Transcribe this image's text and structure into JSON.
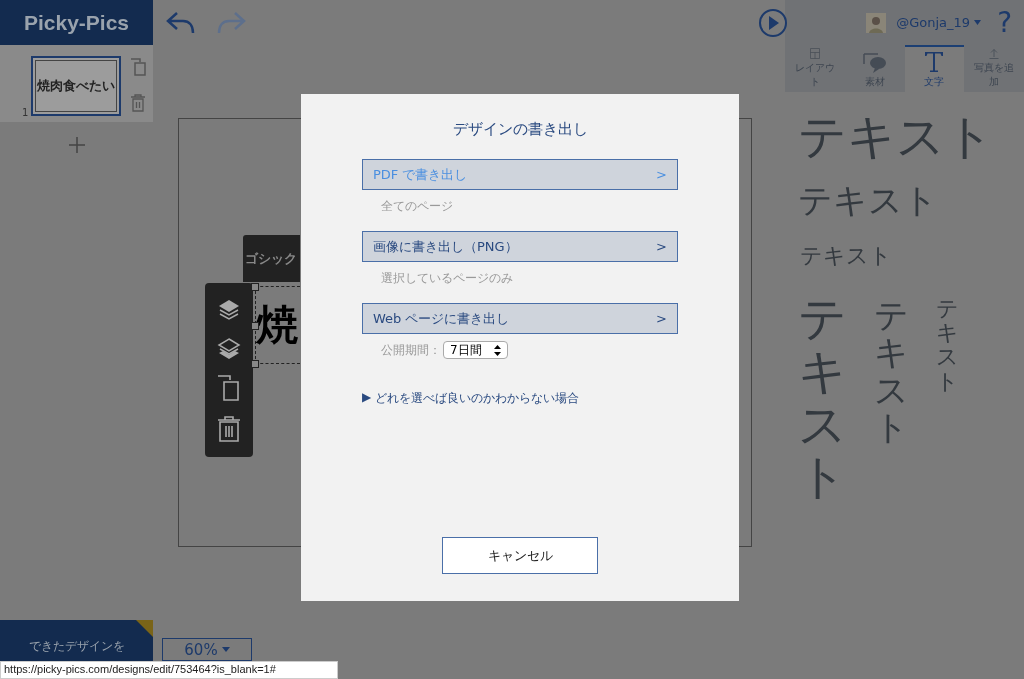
{
  "app": {
    "logo": "Picky-Pics"
  },
  "pages": [
    {
      "number": "1",
      "thumbnail_text": "焼肉食べたい",
      "selected": true
    }
  ],
  "user": {
    "name": "@Gonja_19",
    "help": "?"
  },
  "tabs": [
    {
      "label": "レイアウト",
      "kind": "layout",
      "selected": false
    },
    {
      "label": "素材",
      "kind": "material",
      "selected": false
    },
    {
      "label": "文字",
      "kind": "text",
      "selected": true
    },
    {
      "label": "写真を追加",
      "kind": "upload",
      "selected": false
    }
  ],
  "text_samples": [
    {
      "text": "テキスト",
      "kind": "horizontal"
    },
    {
      "text": "テキスト",
      "kind": "horizontal"
    },
    {
      "text": "テキスト",
      "kind": "horizontal"
    },
    {
      "text": "テキスト",
      "kind": "vertical"
    },
    {
      "text": "テキスト",
      "kind": "vertical"
    },
    {
      "text": "テキスト",
      "kind": "vertical"
    }
  ],
  "canvas": {
    "font_label": "ゴシック",
    "text": "焼"
  },
  "export_button": "できたデザインを",
  "zoom": {
    "value": "60%"
  },
  "dialog": {
    "title": "デザインの書き出し",
    "options": [
      {
        "label": "PDF で書き出し",
        "arrow": ">",
        "kind": "note",
        "note": "全てのページ",
        "hovered": true
      },
      {
        "label": "画像に書き出し（PNG）",
        "arrow": ">",
        "kind": "note",
        "note": "選択しているページのみ",
        "hovered": false
      },
      {
        "label": "Web ページに書き出し",
        "arrow": ">",
        "kind": "period",
        "note": "公開期間：",
        "value": "7日間",
        "hovered": false
      }
    ],
    "help_marker": "▶",
    "help_link": "どれを選べば良いのかわからない場合",
    "cancel": "キャンセル"
  },
  "status_url": "https://picky-pics.com/designs/edit/753464?is_blank=1#"
}
